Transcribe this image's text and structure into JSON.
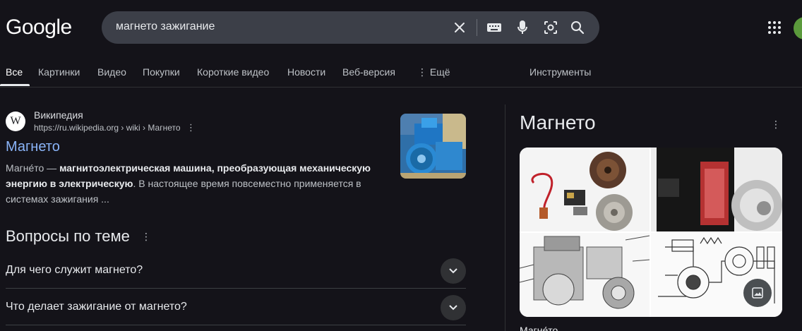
{
  "header": {
    "logo": "Google",
    "search_query": "магнето зажигание",
    "icons": [
      "close-icon",
      "keyboard-icon",
      "mic-icon",
      "lens-icon",
      "search-icon",
      "apps-icon"
    ]
  },
  "tabs": [
    {
      "label": "Все",
      "active": true
    },
    {
      "label": "Картинки"
    },
    {
      "label": "Видео"
    },
    {
      "label": "Покупки"
    },
    {
      "label": "Короткие видео"
    },
    {
      "label": "Новости"
    },
    {
      "label": "Веб-версия"
    },
    {
      "label": "⋮ Ещё"
    }
  ],
  "tools_label": "Инструменты",
  "result": {
    "favicon": "W",
    "site": "Википедия",
    "url": "https://ru.wikipedia.org › wiki › Магнето",
    "title": "Магнето",
    "snippet_start": "Магне́то — ",
    "snippet_bold": "магнитоэлектрическая машина, преобразующая механическую энергию в электрическую",
    "snippet_end": ". В настоящее время повсеместно применяется в системах зажигания ..."
  },
  "paa": {
    "title": "Вопросы по теме",
    "questions": [
      "Для чего служит магнето?",
      "Что делает зажигание от магнето?"
    ]
  },
  "knowledge_panel": {
    "title": "Магнето",
    "bottom_text": "Магне́то"
  },
  "colors": {
    "background": "#141319",
    "link": "#8ab4f8",
    "search_bg": "#3c3f48"
  }
}
